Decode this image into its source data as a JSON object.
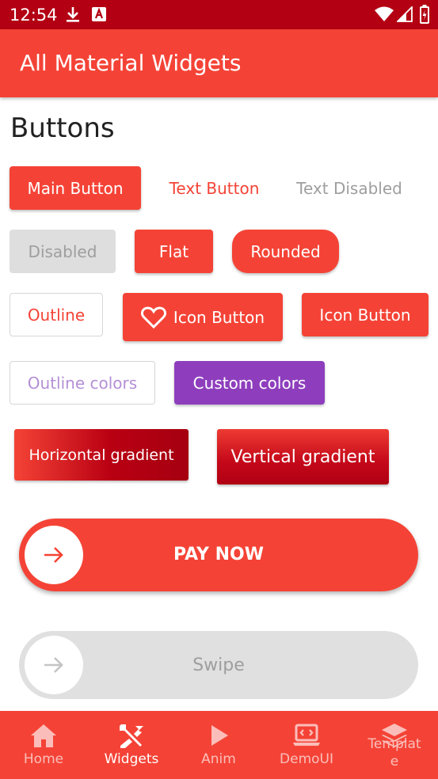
{
  "status_bar": {
    "time": "12:54",
    "icons": [
      "download-icon",
      "a-square-icon",
      "wifi-icon",
      "signal-icon",
      "battery-icon"
    ]
  },
  "app_bar": {
    "title": "All Material Widgets"
  },
  "section": {
    "title": "Buttons"
  },
  "buttons": {
    "main": "Main Button",
    "text": "Text Button",
    "text_disabled": "Text Disabled",
    "disabled": "Disabled",
    "flat": "Flat",
    "rounded": "Rounded",
    "outline": "Outline",
    "icon_button_1": "Icon Button",
    "icon_button_2": "Icon Button",
    "outline_colors": "Outline colors",
    "custom_colors": "Custom colors",
    "horizontal_gradient": "Horizontal gradient",
    "vertical_gradient": "Vertical gradient"
  },
  "swipe_buttons": {
    "pay_now": "PAY NOW",
    "swipe": "Swipe"
  },
  "bottom_nav": {
    "items": [
      {
        "label": "Home",
        "icon": "home-icon",
        "active": false
      },
      {
        "label": "Widgets",
        "icon": "tools-icon",
        "active": true
      },
      {
        "label": "Anim",
        "icon": "play-icon",
        "active": false
      },
      {
        "label": "DemoUI",
        "icon": "laptop-code-icon",
        "active": false
      },
      {
        "label": "Templat e",
        "icon": "layers-icon",
        "active": false
      }
    ]
  },
  "colors": {
    "primary": "#f44336",
    "primary_dark": "#b30013",
    "custom_purple": "#8e3ebd",
    "disabled_gray": "#e0e0e0"
  }
}
